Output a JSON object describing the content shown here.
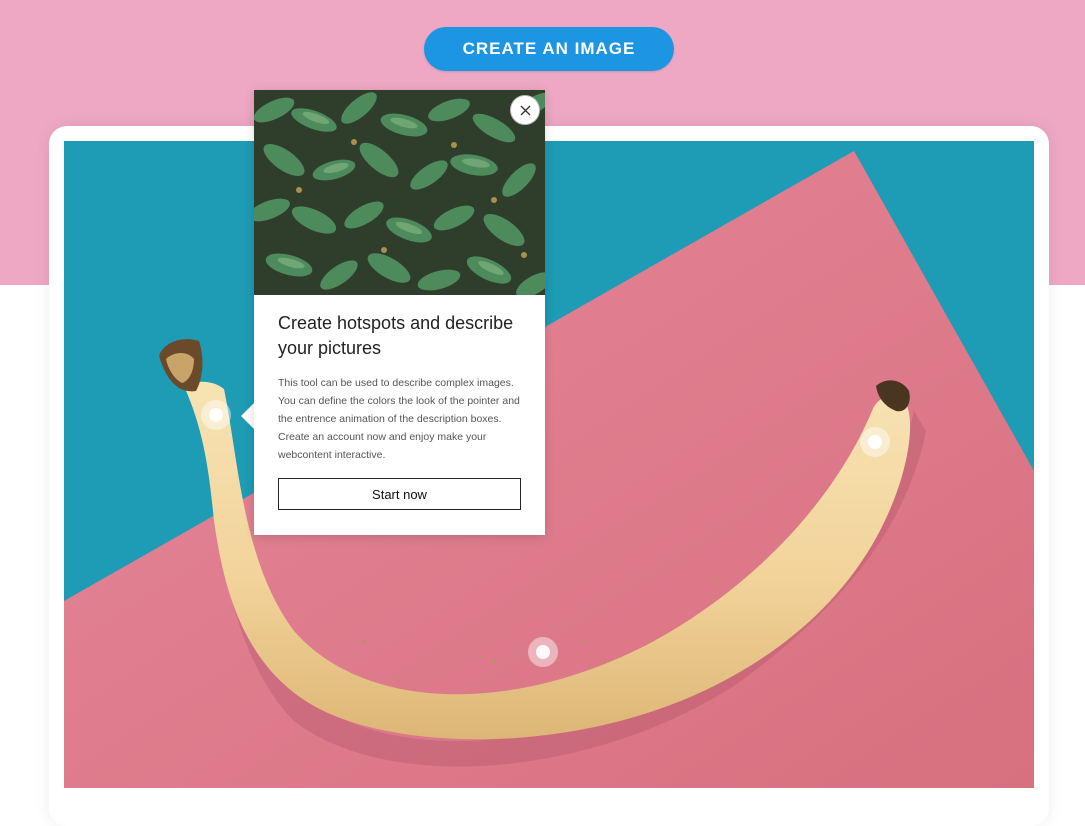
{
  "header": {
    "cta_label": "CREATE AN IMAGE"
  },
  "colors": {
    "page_top_band": "#eea8c4",
    "cta_button": "#1c96e3",
    "photo_teal_background": "#1e9bb5",
    "photo_pink_paper": "#dc7a8e",
    "banana": "#f2d9a2"
  },
  "stage": {
    "hotspots_count": 3
  },
  "popup": {
    "title": "Create hotspots and describe your pictures",
    "description": "This tool can be used to describe complex images. You can define the colors the look of the pointer and the entrence animation of the description boxes. Create an account now and enjoy make your webcontent interactive.",
    "button_label": "Start now",
    "close_icon": "close-icon"
  }
}
